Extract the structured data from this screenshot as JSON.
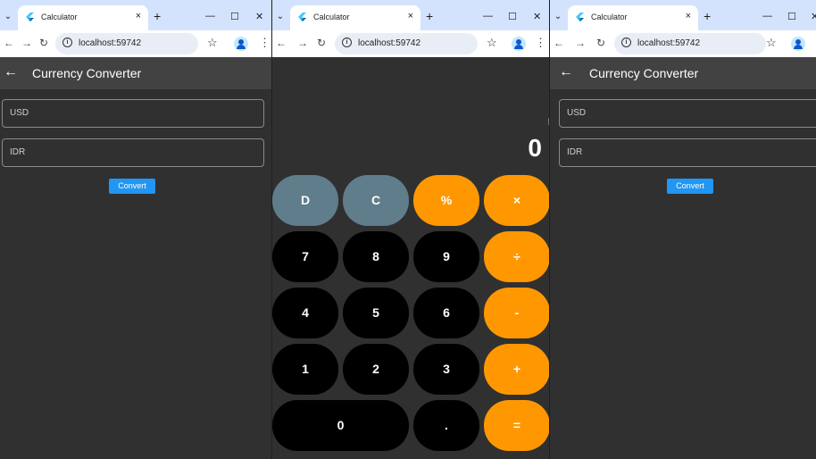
{
  "browser": {
    "tab_title": "Calculator",
    "tab_close": "×",
    "new_tab": "+",
    "minimize": "—",
    "maximize": "☐",
    "close": "✕",
    "tab_list_icon": "chevron-down-icon",
    "url": "localhost:59742"
  },
  "converter": {
    "title": "Currency Converter",
    "from_field": "USD",
    "to_field": "IDR",
    "convert_label": "Convert"
  },
  "calculator": {
    "display": "0",
    "keys": [
      {
        "label": "D",
        "kind": "function"
      },
      {
        "label": "C",
        "kind": "function"
      },
      {
        "label": "%",
        "kind": "operator"
      },
      {
        "label": "×",
        "kind": "operator"
      },
      {
        "label": "7",
        "kind": "number"
      },
      {
        "label": "8",
        "kind": "number"
      },
      {
        "label": "9",
        "kind": "number"
      },
      {
        "label": "÷",
        "kind": "operator"
      },
      {
        "label": "4",
        "kind": "number"
      },
      {
        "label": "5",
        "kind": "number"
      },
      {
        "label": "6",
        "kind": "number"
      },
      {
        "label": "-",
        "kind": "operator"
      },
      {
        "label": "1",
        "kind": "number"
      },
      {
        "label": "2",
        "kind": "number"
      },
      {
        "label": "3",
        "kind": "number"
      },
      {
        "label": "+",
        "kind": "operator"
      },
      {
        "label": "0",
        "kind": "number"
      },
      {
        "label": ".",
        "kind": "number"
      },
      {
        "label": "=",
        "kind": "operator"
      }
    ]
  },
  "colors": {
    "function_key": "#607d8b",
    "operator_key": "#ff9800",
    "number_key": "#000000",
    "convert_button": "#2196f3",
    "tab_strip": "#d3e3fd"
  }
}
